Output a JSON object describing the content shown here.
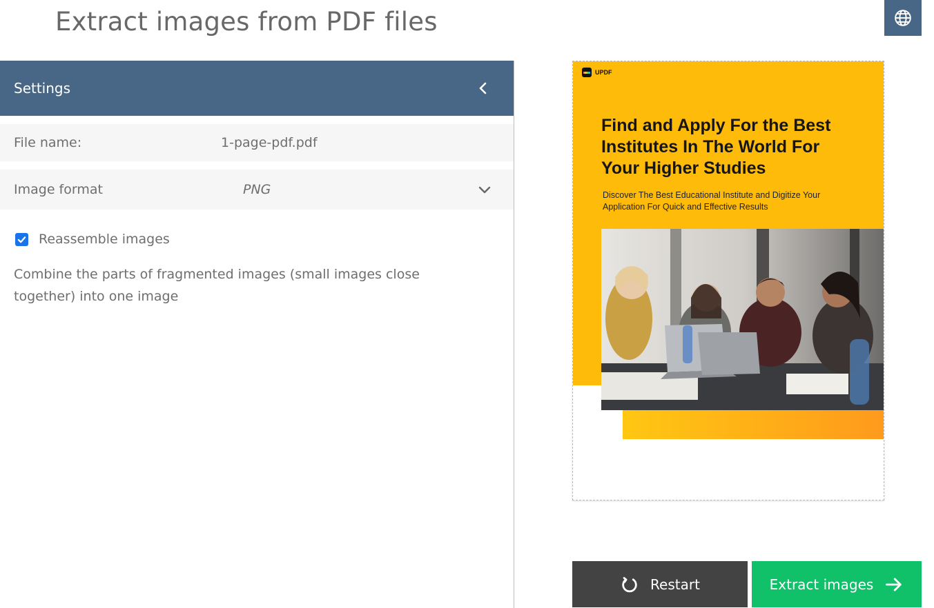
{
  "page": {
    "title": "Extract images from PDF files"
  },
  "header": {
    "language_icon": "globe-icon"
  },
  "settings": {
    "title": "Settings",
    "collapse_icon": "chevron-left-icon",
    "file_name_label": "File name:",
    "file_name_value": "1-page-pdf.pdf",
    "image_format_label": "Image format",
    "image_format_value": "PNG",
    "reassemble": {
      "label": "Reassemble images",
      "checked": true
    },
    "description": "Combine the parts of fragmented images (small images close together) into one image"
  },
  "preview": {
    "brand": "UPDF",
    "heading": "Find and Apply For the Best Institutes In The World For Your Higher Studies",
    "subheading": "Discover The Best Educational Institute and Digitize Your Application For Quick and Effective Results"
  },
  "actions": {
    "restart_label": "Restart",
    "extract_label": "Extract images"
  },
  "colors": {
    "header_blue": "#486686",
    "restart_bg": "#434343",
    "extract_bg": "#10c169",
    "doc_yellow": "#ffbb0a"
  }
}
